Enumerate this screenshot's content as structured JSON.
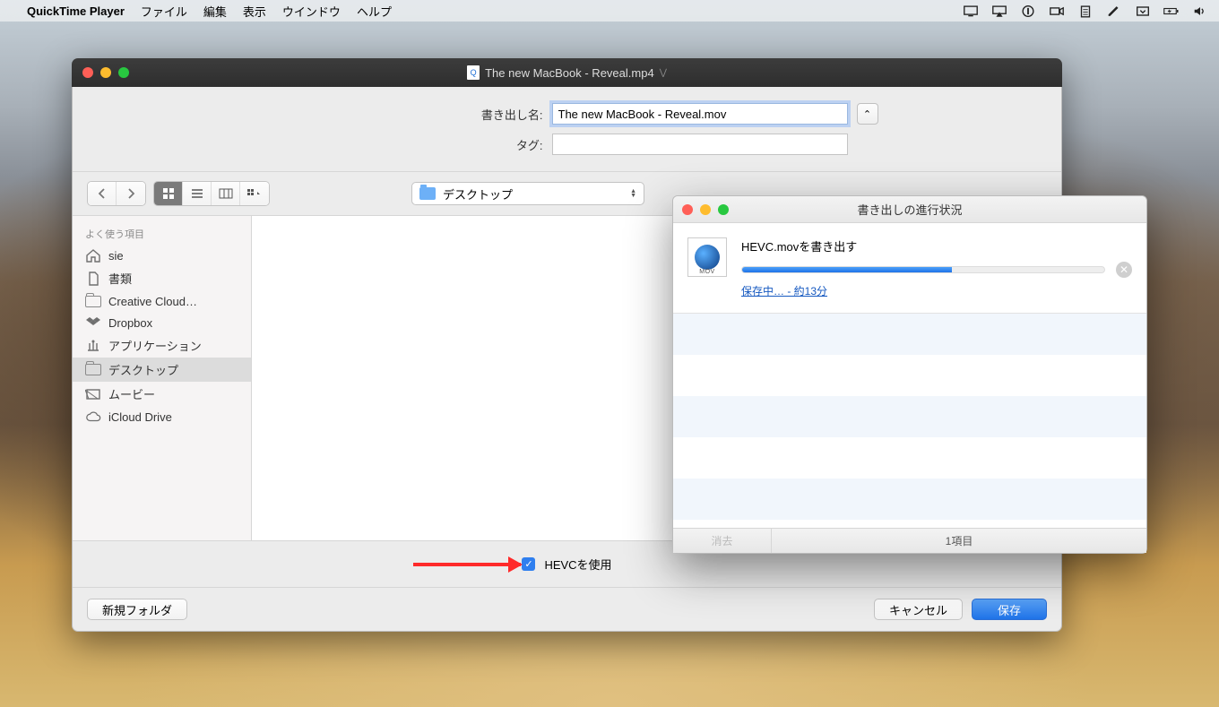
{
  "menubar": {
    "app_name": "QuickTime Player",
    "items": [
      "ファイル",
      "編集",
      "表示",
      "ウインドウ",
      "ヘルプ"
    ]
  },
  "window": {
    "title": "The new MacBook - Reveal.mp4"
  },
  "export_sheet": {
    "name_label": "書き出し名:",
    "name_value": "The new MacBook - Reveal.mov",
    "tags_label": "タグ:",
    "location": "デスクトップ",
    "hevc_label": "HEVCを使用",
    "hevc_checked": true,
    "new_folder_btn": "新規フォルダ",
    "cancel_btn": "キャンセル",
    "save_btn": "保存"
  },
  "sidebar": {
    "favorites_header": "よく使う項目",
    "items": [
      {
        "icon": "home",
        "label": "sie"
      },
      {
        "icon": "doc",
        "label": "書類"
      },
      {
        "icon": "folder",
        "label": "Creative Cloud…"
      },
      {
        "icon": "dropbox",
        "label": "Dropbox"
      },
      {
        "icon": "apps",
        "label": "アプリケーション"
      },
      {
        "icon": "desktop",
        "label": "デスクトップ",
        "selected": true
      },
      {
        "icon": "movies",
        "label": "ムービー"
      },
      {
        "icon": "icloud",
        "label": "iCloud Drive"
      }
    ]
  },
  "progress": {
    "title": "書き出しの進行状況",
    "file_name": "HEVC.movを書き出す",
    "status_prefix": "保存中…",
    "status_time": " - 約13分",
    "percent": 58,
    "clear_btn": "消去",
    "count_label": "1項目"
  }
}
